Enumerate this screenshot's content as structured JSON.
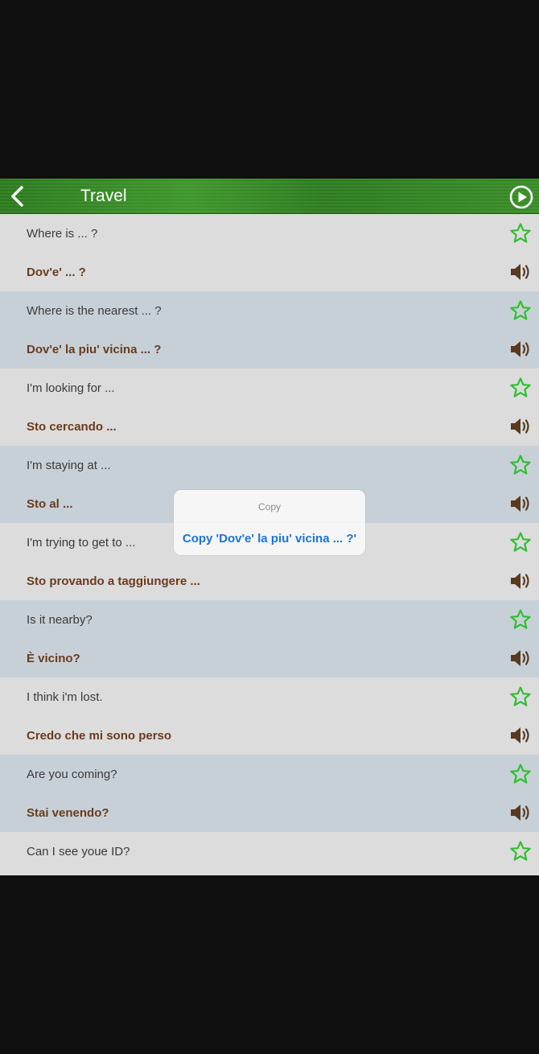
{
  "navbar": {
    "title": "Travel",
    "back_icon": "chevron-left-icon",
    "play_icon": "play-circle-icon"
  },
  "colors": {
    "nav_green": "#3a8f28",
    "row_light": "#dcdcdc",
    "row_blue_gray": "#c8d0d7",
    "italian_text": "#6b3b1e",
    "star_green": "#2fbf2f",
    "speaker_brown": "#5a3a1e",
    "popup_action": "#1a73d8"
  },
  "phrases": [
    {
      "en": "Where is ... ?",
      "it": "Dov'e' ... ?"
    },
    {
      "en": "Where is the nearest ... ?",
      "it": "Dov'e' la piu' vicina ... ?"
    },
    {
      "en": "I'm looking for ...",
      "it": "Sto cercando ..."
    },
    {
      "en": "I'm staying at ...",
      "it": "Sto al ..."
    },
    {
      "en": "I'm trying to get to ...",
      "it": "Sto provando a taggiungere ..."
    },
    {
      "en": "Is it nearby?",
      "it": "È vicino?"
    },
    {
      "en": "I think i'm lost.",
      "it": "Credo che mi sono perso"
    },
    {
      "en": "Are you coming?",
      "it": "Stai venendo?"
    },
    {
      "en": "Can I see youe ID?",
      "it": ""
    }
  ],
  "icons": {
    "favorite": "star-outline-icon",
    "audio": "speaker-icon"
  },
  "popup": {
    "title": "Copy",
    "action": "Copy 'Dov'e' la piu' vicina ... ?'"
  }
}
